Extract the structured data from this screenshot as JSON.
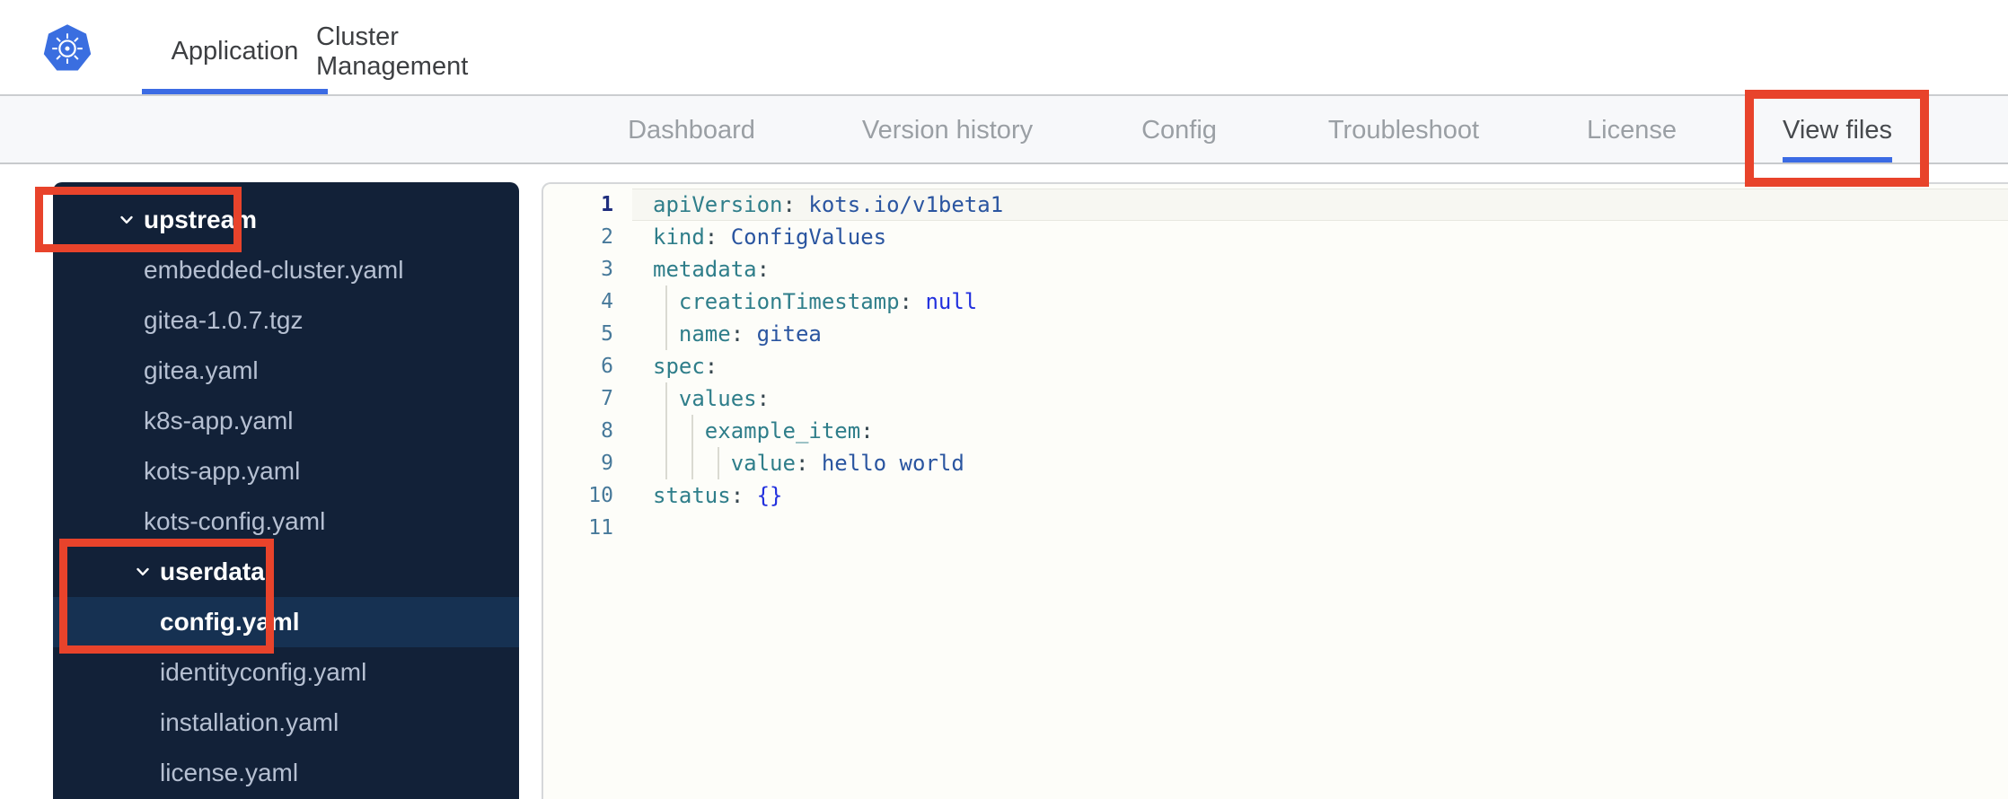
{
  "colors": {
    "accent-blue": "#3b6be4",
    "annotation-red": "#e8432b",
    "sidebar-bg": "#122138",
    "sidebar-selected-bg": "#163152",
    "sidebar-file-text": "#b6c0d2",
    "sidebar-folder-text": "#ffffff",
    "code-key": "#2f7e8a",
    "code-value": "#2a55a0",
    "code-atom": "#2230de",
    "code-punct": "#37474f",
    "gutter-number": "#47799a",
    "gutter-number-active": "#1f2e7e"
  },
  "header": {
    "tabs": [
      {
        "label": "Application",
        "active": true
      },
      {
        "label": "Cluster Management",
        "active": false
      }
    ]
  },
  "subnav": {
    "active": "View files",
    "tabs": [
      {
        "label": "Dashboard",
        "active": false
      },
      {
        "label": "Version history",
        "active": false
      },
      {
        "label": "Config",
        "active": false
      },
      {
        "label": "Troubleshoot",
        "active": false
      },
      {
        "label": "License",
        "active": false
      },
      {
        "label": "View files",
        "active": true
      }
    ]
  },
  "file_tree": {
    "items": [
      {
        "label": "upstream",
        "kind": "folder",
        "level": 0,
        "expanded": true,
        "annotated": true
      },
      {
        "label": "embedded-cluster.yaml",
        "kind": "file",
        "level": 1
      },
      {
        "label": "gitea-1.0.7.tgz",
        "kind": "file",
        "level": 1
      },
      {
        "label": "gitea.yaml",
        "kind": "file",
        "level": 1
      },
      {
        "label": "k8s-app.yaml",
        "kind": "file",
        "level": 1
      },
      {
        "label": "kots-app.yaml",
        "kind": "file",
        "level": 1
      },
      {
        "label": "kots-config.yaml",
        "kind": "file",
        "level": 1
      },
      {
        "label": "userdata",
        "kind": "folder",
        "level": 1,
        "expanded": true,
        "annotated": true
      },
      {
        "label": "config.yaml",
        "kind": "file",
        "level": 2,
        "selected": true,
        "annotated": true
      },
      {
        "label": "identityconfig.yaml",
        "kind": "file",
        "level": 2
      },
      {
        "label": "installation.yaml",
        "kind": "file",
        "level": 2
      },
      {
        "label": "license.yaml",
        "kind": "file",
        "level": 2
      }
    ]
  },
  "editor": {
    "lines": [
      {
        "number": 1,
        "indent": 0,
        "key": "apiVersion",
        "value": "kots.io/v1beta1",
        "value_type": "plain",
        "active": true
      },
      {
        "number": 2,
        "indent": 0,
        "key": "kind",
        "value": "ConfigValues",
        "value_type": "plain"
      },
      {
        "number": 3,
        "indent": 0,
        "key": "metadata"
      },
      {
        "number": 4,
        "indent": 2,
        "key": "creationTimestamp",
        "value": "null",
        "value_type": "atom"
      },
      {
        "number": 5,
        "indent": 2,
        "key": "name",
        "value": "gitea",
        "value_type": "plain"
      },
      {
        "number": 6,
        "indent": 0,
        "key": "spec"
      },
      {
        "number": 7,
        "indent": 2,
        "key": "values"
      },
      {
        "number": 8,
        "indent": 4,
        "key": "example_item"
      },
      {
        "number": 9,
        "indent": 6,
        "key": "value",
        "value": "hello world",
        "value_type": "plain"
      },
      {
        "number": 10,
        "indent": 0,
        "key": "status",
        "value": "{}",
        "value_type": "atom"
      },
      {
        "number": 11,
        "indent": 0,
        "empty": true
      }
    ]
  },
  "annotations": {
    "color": "#e8432b",
    "boxes": [
      "view-files-tab",
      "upstream-folder",
      "userdata-config-yaml"
    ]
  }
}
